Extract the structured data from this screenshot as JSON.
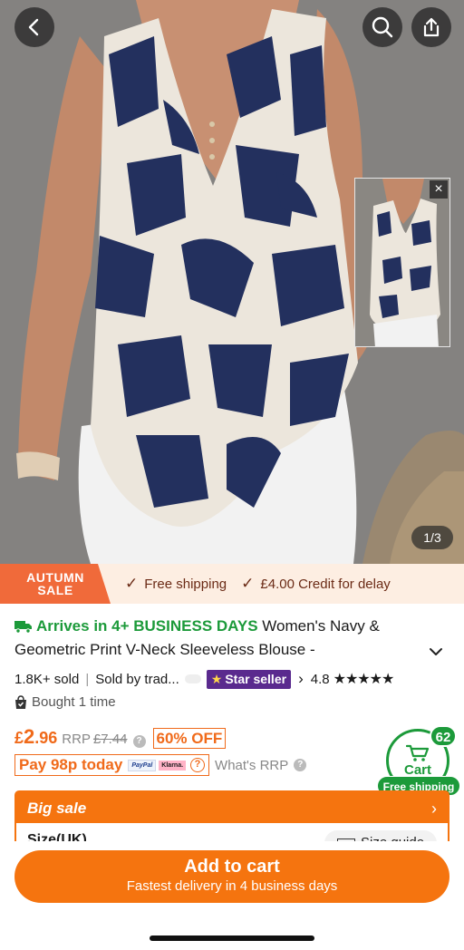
{
  "hero": {
    "image_counter": "1/3",
    "thumb_close": "×",
    "icons": {
      "back": "chevron-left-icon",
      "search": "search-icon",
      "share": "share-icon"
    }
  },
  "promo": {
    "tag_line1": "AUTUMN",
    "tag_line2": "SALE",
    "item1": "Free shipping",
    "item2": "£4.00 Credit for delay",
    "check": "✓"
  },
  "product": {
    "arrival": "Arrives in 4+ BUSINESS DAYS",
    "title_part1": "Women's Navy &",
    "title_part2": "Geometric Print V-Neck Sleeveless Blouse -",
    "sold": "1.8K+ sold",
    "sold_by": "Sold by trad...",
    "star_seller": "Star seller",
    "rating": "4.8",
    "stars": "★★★★★",
    "bought": "Bought 1 time"
  },
  "price": {
    "currency": "£",
    "whole": "2",
    "fraction": ".96",
    "rrp_label": "RRP",
    "rrp_value": "£7.44",
    "discount": "60% OFF",
    "pay_today": "Pay 98p today",
    "paypal": "PayPal",
    "klarna": "Klarna.",
    "whats_rrp": "What's RRP"
  },
  "float_cart": {
    "count": "62",
    "label": "Cart",
    "free_shipping": "Free shipping"
  },
  "big_sale": {
    "title": "Big sale",
    "size_label": "Size(UK)",
    "size_guide": "Size guide"
  },
  "bottom": {
    "add_to_cart": "Add to cart",
    "subtitle": "Fastest delivery in 4 business days"
  },
  "colors": {
    "accent": "#f5740f",
    "green": "#1c9a3a",
    "star_seller": "#5a2a8e",
    "print_navy": "#23305e",
    "print_cream": "#ece6dc"
  }
}
